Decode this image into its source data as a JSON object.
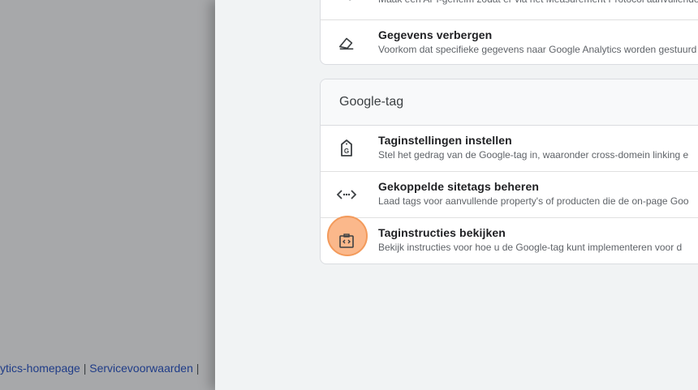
{
  "footer": {
    "link1": "ytics-homepage",
    "sep1": " | ",
    "link2": "Servicevoorwaarden",
    "sep2": " |"
  },
  "top_card": {
    "rows": [
      {
        "title": "",
        "desc": "Maak een API-geheim zodat er via het Measurement Protocol aanvullende",
        "icon": "key-icon"
      },
      {
        "title": "Gegevens verbergen",
        "desc": "Voorkom dat specifieke gegevens naar Google Analytics worden gestuurd",
        "icon": "eraser-icon"
      }
    ]
  },
  "tag_card": {
    "header": "Google-tag",
    "rows": [
      {
        "title": "Taginstellingen instellen",
        "desc": "Stel het gedrag van de Google-tag in, waaronder cross-domein linking e",
        "icon": "google-tag-icon"
      },
      {
        "title": "Gekoppelde sitetags beheren",
        "desc": "Laad tags voor aanvullende property's of producten die de on-page Goo",
        "icon": "code-arrows-icon"
      },
      {
        "title": "Taginstructies bekijken",
        "desc": "Bekijk instructies voor hoe u de Google-tag kunt implementeren voor d",
        "icon": "clipboard-code-icon"
      }
    ]
  },
  "colors": {
    "highlight": "#f39a5b",
    "footer_link": "#1f3c88"
  }
}
